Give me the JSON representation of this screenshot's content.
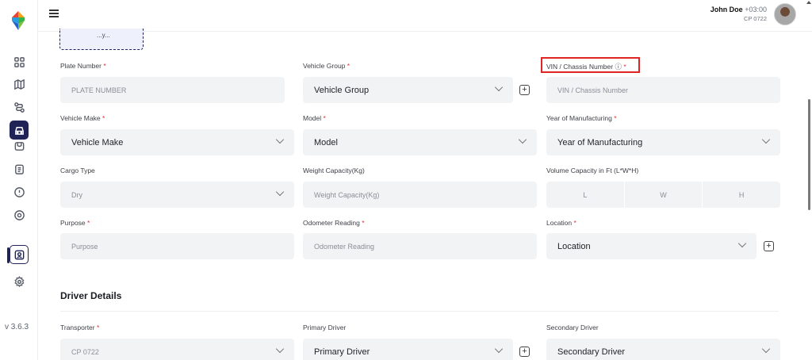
{
  "app": {
    "version": "v 3.6.3"
  },
  "user": {
    "name": "John Doe",
    "timezone": "+03:00",
    "company_code": "CP 0722"
  },
  "sidebar": {
    "items": [
      {
        "name": "dashboard-grid-icon"
      },
      {
        "name": "map-icon"
      },
      {
        "name": "route-icon"
      },
      {
        "name": "vehicle-icon",
        "active": true
      },
      {
        "name": "package-icon"
      },
      {
        "name": "clipboard-icon"
      },
      {
        "name": "alert-icon"
      },
      {
        "name": "location-pin-icon"
      },
      {
        "name": "user-badge-icon",
        "selected": true
      },
      {
        "name": "settings-gear-icon"
      }
    ]
  },
  "vehicle_form": {
    "upload_text": "...y...",
    "plate_number": {
      "label": "Plate Number",
      "placeholder": "PLATE NUMBER"
    },
    "vehicle_group": {
      "label": "Vehicle Group",
      "value": "Vehicle Group"
    },
    "vin": {
      "label": "VIN / Chassis Number ⓘ",
      "placeholder": "VIN / Chassis Number"
    },
    "vehicle_make": {
      "label": "Vehicle Make",
      "value": "Vehicle Make"
    },
    "model": {
      "label": "Model",
      "value": "Model"
    },
    "year": {
      "label": "Year of Manufacturing",
      "value": "Year of Manufacturing"
    },
    "cargo_type": {
      "label": "Cargo Type",
      "value": "Dry"
    },
    "weight_capacity": {
      "label": "Weight Capacity(Kg)",
      "placeholder": "Weight Capacity(Kg)"
    },
    "volume_capacity": {
      "label": "Volume Capacity in Ft (L*W*H)",
      "l": "L",
      "w": "W",
      "h": "H"
    },
    "purpose": {
      "label": "Purpose",
      "placeholder": "Purpose"
    },
    "odometer": {
      "label": "Odometer Reading",
      "placeholder": "Odometer Reading"
    },
    "location": {
      "label": "Location",
      "value": "Location"
    }
  },
  "driver_details": {
    "title": "Driver Details",
    "transporter": {
      "label": "Transporter",
      "value": "CP 0722"
    },
    "primary_driver": {
      "label": "Primary Driver",
      "value": "Primary Driver"
    },
    "secondary_driver": {
      "label": "Secondary Driver",
      "value": "Secondary Driver"
    }
  },
  "required_marker": "*",
  "colors": {
    "accent": "#1f2356",
    "required": "#e03131",
    "highlight": "#e02424",
    "field_bg": "#f2f3f5"
  }
}
